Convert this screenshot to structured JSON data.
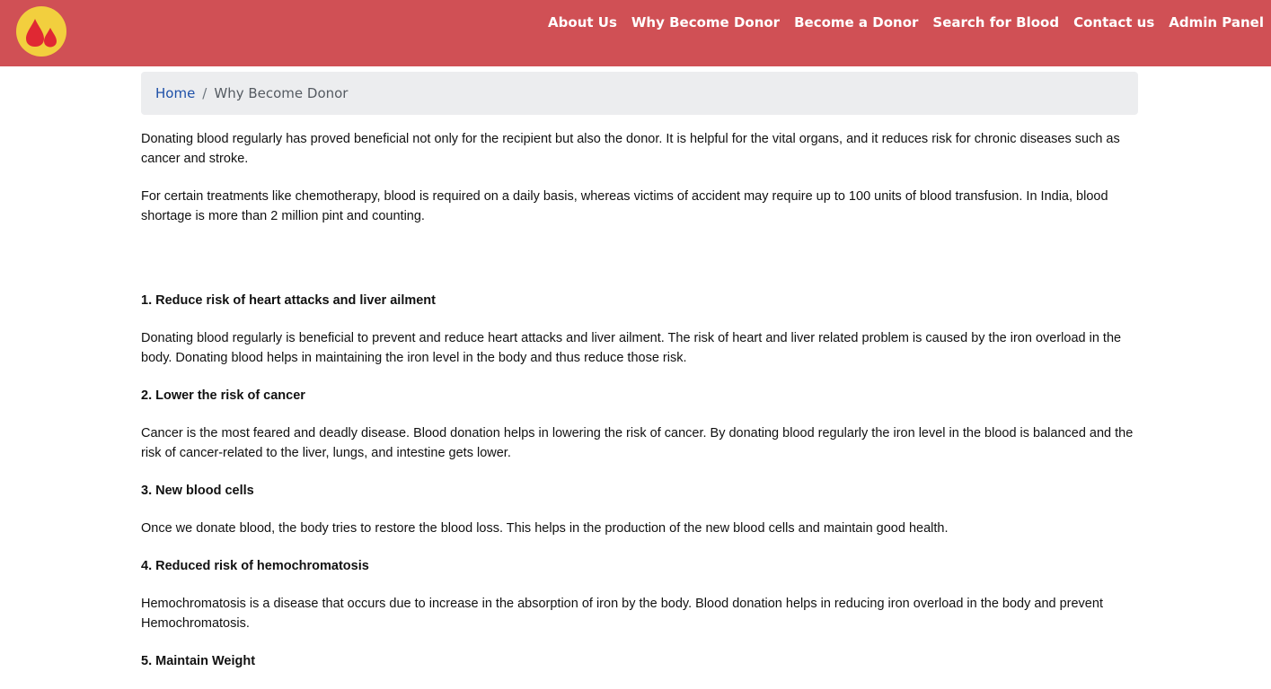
{
  "brand": {
    "logo_icon": "blood-drops-icon",
    "logo_bg": "#f2cf3e",
    "drop_color": "#e02833"
  },
  "nav": {
    "background": "#d05055",
    "items": [
      "About Us",
      "Why Become Donor",
      "Become a Donor",
      "Search for Blood",
      "Contact us",
      "Admin Panel"
    ]
  },
  "breadcrumb": {
    "home": "Home",
    "separator": "/",
    "current": "Why Become Donor"
  },
  "intro": [
    "Donating blood regularly has proved beneficial not only for the recipient but also the donor. It is helpful for the vital organs, and it reduces risk for chronic diseases such as cancer and stroke.",
    "For certain treatments like chemotherapy, blood is required on a daily basis, whereas victims of accident may require up to 100 units of blood transfusion. In India, blood shortage is more than 2 million pint and counting."
  ],
  "benefits": [
    {
      "title": "1. Reduce risk of heart attacks and liver ailment",
      "text": "Donating blood regularly is beneficial to prevent and reduce heart attacks and liver ailment. The risk of heart and liver related problem is caused by the iron overload in the body. Donating blood helps in maintaining the iron level in the body and thus reduce those risk."
    },
    {
      "title": "2. Lower the risk of cancer",
      "text": "Cancer is the most feared and deadly disease. Blood donation helps in lowering the risk of cancer. By donating blood regularly the iron level in the blood is balanced and the risk of cancer-related to the liver, lungs, and intestine gets lower."
    },
    {
      "title": "3. New blood cells",
      "text": "Once we donate blood, the body tries to restore the blood loss. This helps in the production of the new blood cells and maintain good health."
    },
    {
      "title": "4. Reduced risk of hemochromatosis",
      "text": "Hemochromatosis is a disease that occurs due to increase in the absorption of iron by the body. Blood donation helps in reducing iron overload in the body and prevent Hemochromatosis."
    },
    {
      "title": "5. Maintain Weight",
      "text": ""
    }
  ]
}
